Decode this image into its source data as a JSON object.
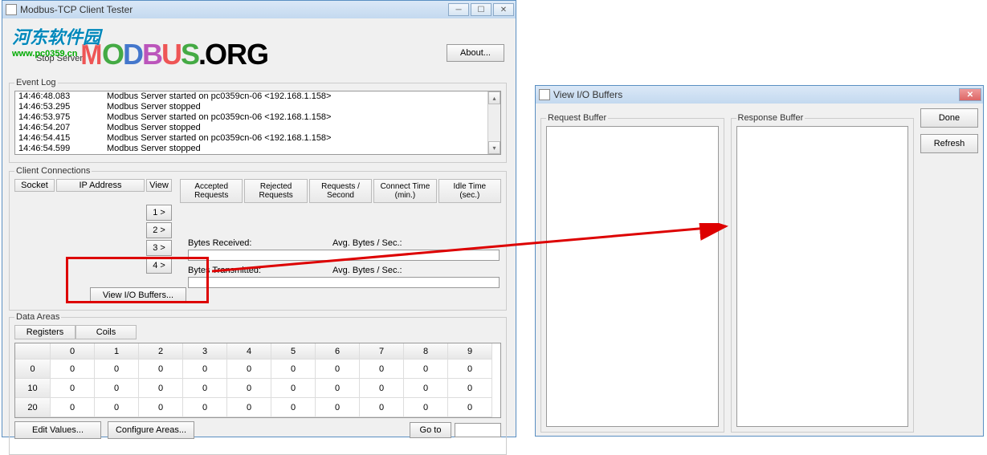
{
  "window1": {
    "title": "Modbus-TCP Client Tester",
    "watermark_cn": "河东软件园",
    "watermark_url": "www.pc0359.cn",
    "stop_server": "Stop Server",
    "about": "About...",
    "event_log": {
      "legend": "Event Log",
      "entries": [
        {
          "ts": "14:46:48.083",
          "msg": "Modbus Server started on pc0359cn-06 <192.168.1.158>"
        },
        {
          "ts": "14:46:53.295",
          "msg": "Modbus Server stopped"
        },
        {
          "ts": "14:46:53.975",
          "msg": "Modbus Server started on pc0359cn-06 <192.168.1.158>"
        },
        {
          "ts": "14:46:54.207",
          "msg": "Modbus Server stopped"
        },
        {
          "ts": "14:46:54.415",
          "msg": "Modbus Server started on pc0359cn-06 <192.168.1.158>"
        },
        {
          "ts": "14:46:54.599",
          "msg": "Modbus Server stopped"
        }
      ]
    },
    "conn": {
      "legend": "Client Connections",
      "cols": {
        "socket": "Socket",
        "ip": "IP Address",
        "view": "View"
      },
      "stats": [
        "Accepted Requests",
        "Rejected Requests",
        "Requests / Second",
        "Connect Time (min.)",
        "Idle Time (sec.)"
      ],
      "view_buttons": [
        "1 >",
        "2 >",
        "3 >",
        "4 >"
      ],
      "bytes_recv": "Bytes Received:",
      "avg_bytes_sec": "Avg. Bytes / Sec.:",
      "bytes_trans": "Bytes Transmitted:",
      "avg_bytes_sec2": "Avg. Bytes / Sec.:",
      "io_buffers": "View I/O Buffers..."
    },
    "data": {
      "legend": "Data Areas",
      "tabs": [
        "Registers",
        "Coils"
      ],
      "col_heads": [
        "0",
        "1",
        "2",
        "3",
        "4",
        "5",
        "6",
        "7",
        "8",
        "9"
      ],
      "rows": [
        {
          "h": "0",
          "v": [
            "0",
            "0",
            "0",
            "0",
            "0",
            "0",
            "0",
            "0",
            "0",
            "0"
          ]
        },
        {
          "h": "10",
          "v": [
            "0",
            "0",
            "0",
            "0",
            "0",
            "0",
            "0",
            "0",
            "0",
            "0"
          ]
        },
        {
          "h": "20",
          "v": [
            "0",
            "0",
            "0",
            "0",
            "0",
            "0",
            "0",
            "0",
            "0",
            "0"
          ]
        }
      ],
      "edit": "Edit Values...",
      "configure": "Configure Areas...",
      "goto": "Go to"
    }
  },
  "window2": {
    "title": "View I/O Buffers",
    "request": "Request Buffer",
    "response": "Response Buffer",
    "done": "Done",
    "refresh": "Refresh"
  }
}
